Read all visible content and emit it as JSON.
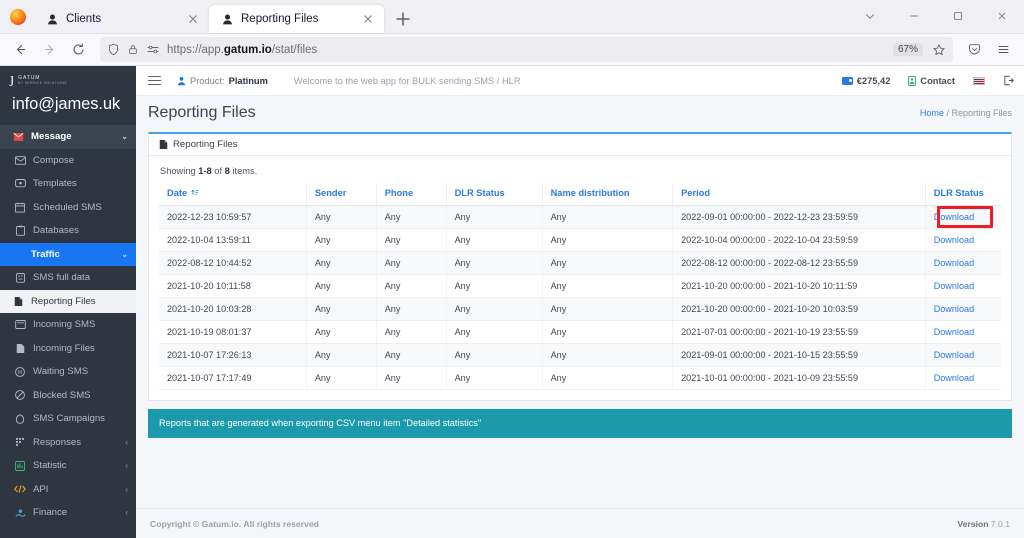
{
  "browser": {
    "tabs": [
      {
        "title": "Clients",
        "active": false
      },
      {
        "title": "Reporting Files",
        "active": true
      }
    ],
    "url_prefix": "https://app.",
    "url_domain": "gatum.io",
    "url_suffix": "/stat/files",
    "zoom": "67%"
  },
  "sidebar": {
    "logo_line1": "GATUM",
    "logo_line2": "BY SERVICE SOLUTIONS",
    "user_email": "info@james.uk",
    "items": [
      {
        "label": "Message",
        "icon": "message-icon",
        "state": "group",
        "chevron": "⌄"
      },
      {
        "label": "Compose",
        "icon": "envelope-icon",
        "state": "sub",
        "chevron": ""
      },
      {
        "label": "Templates",
        "icon": "template-icon",
        "state": "sub",
        "chevron": ""
      },
      {
        "label": "Scheduled SMS",
        "icon": "calendar-icon",
        "state": "sub",
        "chevron": ""
      },
      {
        "label": "Databases",
        "icon": "database-icon",
        "state": "sub",
        "chevron": ""
      },
      {
        "label": "Traffic",
        "icon": "",
        "state": "active",
        "chevron": "⌄"
      },
      {
        "label": "SMS full data",
        "icon": "chip-icon",
        "state": "sub",
        "chevron": ""
      },
      {
        "label": "Reporting Files",
        "icon": "file-report-icon",
        "state": "selected",
        "chevron": ""
      },
      {
        "label": "Incoming SMS",
        "icon": "inbox-icon",
        "state": "sub",
        "chevron": ""
      },
      {
        "label": "Incoming Files",
        "icon": "file-in-icon",
        "state": "sub",
        "chevron": ""
      },
      {
        "label": "Waiting SMS",
        "icon": "clock-icon",
        "state": "sub",
        "chevron": ""
      },
      {
        "label": "Blocked SMS",
        "icon": "blocked-icon",
        "state": "sub",
        "chevron": ""
      },
      {
        "label": "SMS Campaigns",
        "icon": "campaign-icon",
        "state": "sub",
        "chevron": ""
      },
      {
        "label": "Responses",
        "icon": "responses-icon",
        "state": "sub",
        "chevron": "‹"
      },
      {
        "label": "Statistic",
        "icon": "chart-icon",
        "state": "sub",
        "chevron": "‹"
      },
      {
        "label": "API",
        "icon": "code-icon",
        "state": "sub",
        "chevron": "‹"
      },
      {
        "label": "Finance",
        "icon": "finance-icon",
        "state": "sub",
        "chevron": "‹"
      }
    ]
  },
  "topbar": {
    "product_label": "Product:",
    "product_value": "Platinum",
    "welcome": "Welcome to the web app for BULK sending SMS / HLR",
    "balance": "€275,42",
    "contact": "Contact",
    "language_icon": "us-flag-icon",
    "logout_icon": "logout-icon"
  },
  "page": {
    "title": "Reporting Files",
    "breadcrumb_home": "Home",
    "breadcrumb_sep": "/",
    "breadcrumb_current": "Reporting Files",
    "card_title": "Reporting Files",
    "showing_prefix": "Showing",
    "showing_range": "1-8",
    "showing_of": "of",
    "showing_total": "8",
    "showing_suffix": "items."
  },
  "table": {
    "columns": [
      "Date",
      "Sender",
      "Phone",
      "DLR Status",
      "Name distribution",
      "Period",
      "DLR Status"
    ],
    "sort_column": "Date",
    "sort_icon": "sort-ascending-icon",
    "download_label": "Download",
    "rows": [
      {
        "date": "2022-12-23 10:59:57",
        "sender": "Any",
        "phone": "Any",
        "dlr_status": "Any",
        "name_distribution": "Any",
        "period": "2022-09-01 00:00:00 - 2022-12-23 23:59:59",
        "action": "Download",
        "highlighted": true
      },
      {
        "date": "2022-10-04 13:59:11",
        "sender": "Any",
        "phone": "Any",
        "dlr_status": "Any",
        "name_distribution": "Any",
        "period": "2022-10-04 00:00:00 - 2022-10-04 23:59:59",
        "action": "Download",
        "highlighted": false
      },
      {
        "date": "2022-08-12 10:44:52",
        "sender": "Any",
        "phone": "Any",
        "dlr_status": "Any",
        "name_distribution": "Any",
        "period": "2022-08-12 00:00:00 - 2022-08-12 23:55:59",
        "action": "Download",
        "highlighted": false
      },
      {
        "date": "2021-10-20 10:11:58",
        "sender": "Any",
        "phone": "Any",
        "dlr_status": "Any",
        "name_distribution": "Any",
        "period": "2021-10-20 00:00:00 - 2021-10-20 10:11:59",
        "action": "Download",
        "highlighted": false
      },
      {
        "date": "2021-10-20 10:03:28",
        "sender": "Any",
        "phone": "Any",
        "dlr_status": "Any",
        "name_distribution": "Any",
        "period": "2021-10-20 00:00:00 - 2021-10-20 10:03:59",
        "action": "Download",
        "highlighted": false
      },
      {
        "date": "2021-10-19 08:01:37",
        "sender": "Any",
        "phone": "Any",
        "dlr_status": "Any",
        "name_distribution": "Any",
        "period": "2021-07-01 00:00:00 - 2021-10-19 23:55:59",
        "action": "Download",
        "highlighted": false
      },
      {
        "date": "2021-10-07 17:26:13",
        "sender": "Any",
        "phone": "Any",
        "dlr_status": "Any",
        "name_distribution": "Any",
        "period": "2021-09-01 00:00:00 - 2021-10-15 23:55:59",
        "action": "Download",
        "highlighted": false
      },
      {
        "date": "2021-10-07 17:17:49",
        "sender": "Any",
        "phone": "Any",
        "dlr_status": "Any",
        "name_distribution": "Any",
        "period": "2021-10-01 00:00:00 - 2021-10-09 23:55:59",
        "action": "Download",
        "highlighted": false
      }
    ]
  },
  "info_bar": {
    "text": "Reports that are generated when exporting CSV menu item \"Detailed statistics\""
  },
  "footer": {
    "copyright": "Copyright © Gatum.io. All rights reserved",
    "version_label": "Version",
    "version_value": "7.0.1"
  },
  "colors": {
    "accent_blue": "#1876f2",
    "link_blue": "#2a7ae2",
    "sidebar_bg": "#2f3640",
    "info_teal": "#1c9aab",
    "highlight_red": "#ee1c25"
  }
}
